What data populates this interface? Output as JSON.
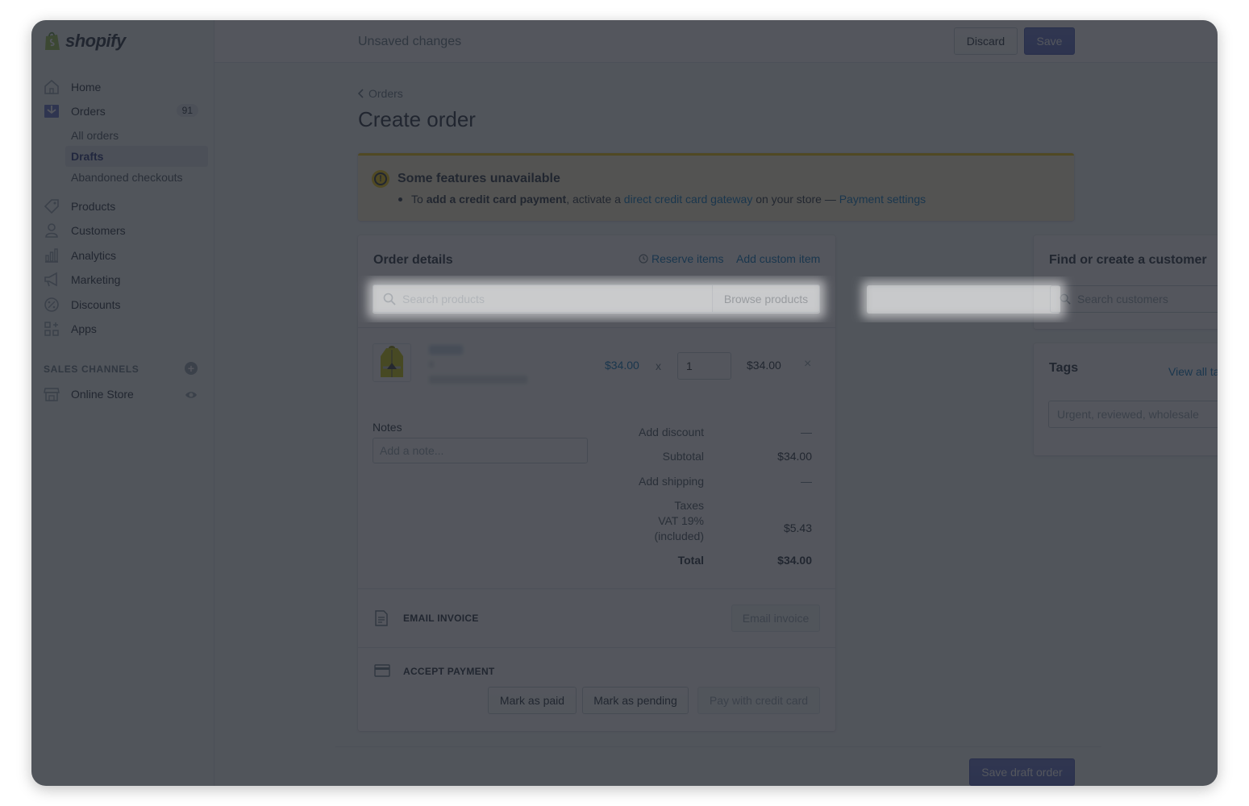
{
  "brand": {
    "name": "shopify"
  },
  "sidebar": {
    "items": [
      {
        "label": "Home",
        "icon": "home-icon"
      },
      {
        "label": "Orders",
        "icon": "orders-icon",
        "badge": "91"
      },
      {
        "label": "Products",
        "icon": "tag-icon"
      },
      {
        "label": "Customers",
        "icon": "person-icon"
      },
      {
        "label": "Analytics",
        "icon": "bar-chart-icon"
      },
      {
        "label": "Marketing",
        "icon": "megaphone-icon"
      },
      {
        "label": "Discounts",
        "icon": "discount-icon"
      },
      {
        "label": "Apps",
        "icon": "apps-icon"
      }
    ],
    "order_subitems": [
      {
        "label": "All orders"
      },
      {
        "label": "Drafts",
        "active": true
      },
      {
        "label": "Abandoned checkouts"
      }
    ],
    "channels_title": "SALES CHANNELS",
    "channels": [
      {
        "label": "Online Store",
        "icon": "store-icon"
      }
    ]
  },
  "topbar": {
    "status": "Unsaved changes",
    "discard_label": "Discard",
    "save_label": "Save"
  },
  "page": {
    "breadcrumb": "Orders",
    "title": "Create order"
  },
  "banner": {
    "title": "Some features unavailable",
    "text_1": "To ",
    "bold": "add a credit card payment",
    "text_2": ", activate a ",
    "link_1": "direct credit card gateway",
    "text_3": " on your store — ",
    "link_2": "Payment settings"
  },
  "order": {
    "title": "Order details",
    "reserve_label": "Reserve items",
    "add_custom_label": "Add custom item",
    "search_placeholder": "Search products",
    "browse_label": "Browse products",
    "line_item": {
      "price": "$34.00",
      "times": "x",
      "quantity": "1",
      "total": "$34.00",
      "remove": "×"
    },
    "notes_label": "Notes",
    "notes_placeholder": "Add a note...",
    "summary": {
      "add_discount": "Add discount",
      "discount_value": "—",
      "subtotal_label": "Subtotal",
      "subtotal_value": "$34.00",
      "add_shipping": "Add shipping",
      "shipping_value": "—",
      "taxes_label": "Taxes",
      "vat_line_1": "VAT 19%",
      "vat_line_2": "(included)",
      "taxes_value": "$5.43",
      "total_label": "Total",
      "total_value": "$34.00"
    },
    "email_section": {
      "title": "EMAIL INVOICE",
      "button": "Email invoice"
    },
    "payment_section": {
      "title": "ACCEPT PAYMENT",
      "mark_paid": "Mark as paid",
      "mark_pending": "Mark as pending",
      "pay_card": "Pay with credit card"
    }
  },
  "customer": {
    "title": "Find or create a customer",
    "search_placeholder": "Search customers"
  },
  "tags": {
    "title": "Tags",
    "view_all": "View all tags",
    "placeholder": "Urgent, reviewed, wholesale"
  },
  "footer": {
    "save_draft_label": "Save draft order"
  },
  "colors": {
    "primary": "#5c6ac4",
    "link": "#006fbb",
    "banner_bg": "#fcf1cd",
    "banner_accent": "#eec200"
  }
}
